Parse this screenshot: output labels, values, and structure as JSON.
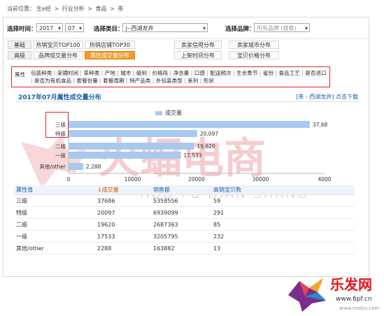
{
  "breadcrumb": [
    "当前位置：",
    "生e经",
    ">",
    "行业分析",
    ">",
    "食品",
    ">",
    "茶"
  ],
  "filters": {
    "time_label": "选择时间：",
    "year": "2017",
    "month": "07",
    "category_label": "选择类目：",
    "category": "|--西湖龙井",
    "brand_label": "选择品牌：",
    "brand_placeholder": "所有品牌 (搜索)"
  },
  "tabs": {
    "row1_label": "基础",
    "row1": [
      "热销宝贝TOP100",
      "热销店铺TOP30",
      "卖家信用分布",
      "卖家城市分布"
    ],
    "row2_label": "高级",
    "row2": [
      "品牌成交量分布",
      "属性成交量分布",
      "上架时间分布",
      "宝贝价格分布"
    ],
    "active": "属性成交量分布"
  },
  "attributes": {
    "title": "属性",
    "items": [
      "包装种类",
      "采摘时间",
      "茶种类",
      "产地",
      "城市",
      "级别",
      "价格段",
      "净含量",
      "口感",
      "配送频次",
      "生长季节",
      "省份",
      "食品工艺",
      "是否进口",
      "是否为有机食品",
      "套餐份量",
      "套餐周期",
      "特产品类",
      "外包装类型",
      "系列",
      "形状"
    ]
  },
  "section": {
    "title": "2017年07月属性成交量分布",
    "crumb": "[茶 - 西湖龙井]",
    "download": "点击下载"
  },
  "chart_data": {
    "type": "bar",
    "orientation": "horizontal",
    "legend": [
      "成交量"
    ],
    "categories": [
      "三级",
      "特级",
      "二级",
      "一级",
      "其他/other"
    ],
    "series": [
      {
        "name": "成交量",
        "values": [
          37686,
          20097,
          19620,
          17533,
          2288
        ]
      }
    ],
    "value_labels": [
      "37,68",
      "20,097",
      "19,620",
      "17,533",
      "2,288"
    ],
    "xlim": [
      0,
      40000
    ],
    "xticks": [
      "0",
      "10000",
      "20000",
      "30000",
      "4000"
    ],
    "color": "#a8c9ee"
  },
  "table": {
    "headers": [
      "属性值",
      "成交量",
      "销售额",
      "高销宝贝数"
    ],
    "rows": [
      [
        "三级",
        "37686",
        "5358556",
        "59"
      ],
      [
        "特级",
        "20097",
        "6939099",
        "291"
      ],
      [
        "二级",
        "19620",
        "2687363",
        "85"
      ],
      [
        "一级",
        "17533",
        "3205795",
        "232"
      ],
      [
        "其他/other",
        "2288",
        "163882",
        "13"
      ]
    ]
  },
  "watermark": {
    "cn": "火蝠电商",
    "en": "HUO FU DIAN SHANG"
  },
  "logo": {
    "text": "乐发网",
    "url": "www.6pf.cn",
    "site": "www.maijia.com"
  },
  "colors": {
    "accent": "#f39a2b",
    "highlight": "#e0242a",
    "link": "#1c5fa8",
    "bar": "#a8c9ee"
  }
}
